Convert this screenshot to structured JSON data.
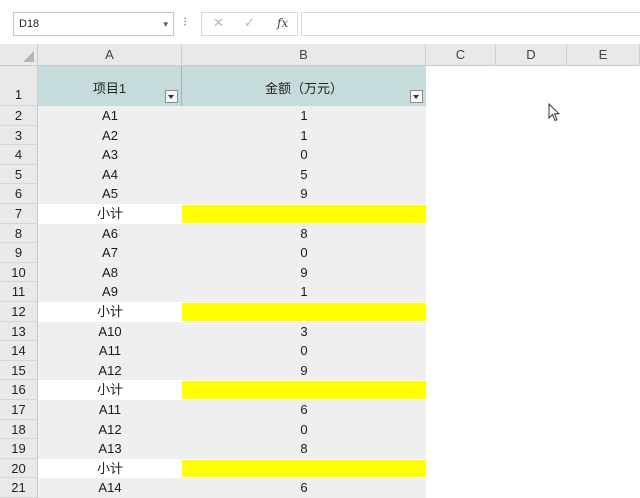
{
  "formula_bar": {
    "name_box": "D18",
    "name_box_dropdown_icon": "chevron-down-icon",
    "cancel_glyph": "✕",
    "enter_glyph": "✓",
    "fx_label": "fx"
  },
  "sheet": {
    "column_headers": [
      "A",
      "B",
      "C",
      "D",
      "E"
    ],
    "header_row": {
      "row_number": "1",
      "col_a": "项目1",
      "col_b": "金额（万元）"
    },
    "rows": [
      {
        "row": "2",
        "a": "A1",
        "b": "1",
        "subtotal": false
      },
      {
        "row": "3",
        "a": "A2",
        "b": "1",
        "subtotal": false
      },
      {
        "row": "4",
        "a": "A3",
        "b": "0",
        "subtotal": false
      },
      {
        "row": "5",
        "a": "A4",
        "b": "5",
        "subtotal": false
      },
      {
        "row": "6",
        "a": "A5",
        "b": "9",
        "subtotal": false
      },
      {
        "row": "7",
        "a": "小计",
        "b": "",
        "subtotal": true
      },
      {
        "row": "8",
        "a": "A6",
        "b": "8",
        "subtotal": false
      },
      {
        "row": "9",
        "a": "A7",
        "b": "0",
        "subtotal": false
      },
      {
        "row": "10",
        "a": "A8",
        "b": "9",
        "subtotal": false
      },
      {
        "row": "11",
        "a": "A9",
        "b": "1",
        "subtotal": false
      },
      {
        "row": "12",
        "a": "小计",
        "b": "",
        "subtotal": true
      },
      {
        "row": "13",
        "a": "A10",
        "b": "3",
        "subtotal": false
      },
      {
        "row": "14",
        "a": "A11",
        "b": "0",
        "subtotal": false
      },
      {
        "row": "15",
        "a": "A12",
        "b": "9",
        "subtotal": false
      },
      {
        "row": "16",
        "a": "小计",
        "b": "",
        "subtotal": true
      },
      {
        "row": "17",
        "a": "A11",
        "b": "6",
        "subtotal": false
      },
      {
        "row": "18",
        "a": "A12",
        "b": "0",
        "subtotal": false
      },
      {
        "row": "19",
        "a": "A13",
        "b": "8",
        "subtotal": false
      },
      {
        "row": "20",
        "a": "小计",
        "b": "",
        "subtotal": true
      },
      {
        "row": "21",
        "a": "A14",
        "b": "6",
        "subtotal": false
      }
    ],
    "colors": {
      "header_fill": "#c6dcdc",
      "band_fill": "#efefef",
      "subtotal_fill": "#ffff00"
    }
  }
}
